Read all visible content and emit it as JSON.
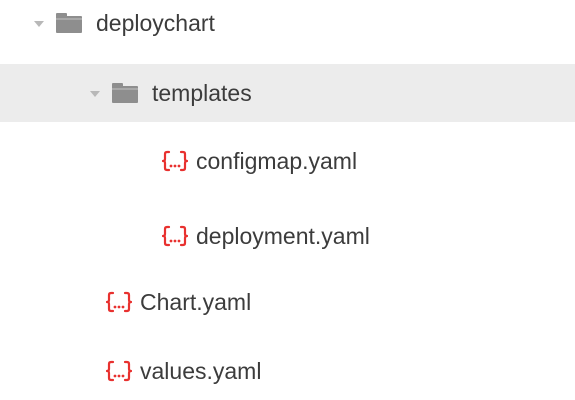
{
  "tree": {
    "root": {
      "label": "deploychart",
      "icon": "folder-icon",
      "expanded": true
    },
    "templates": {
      "label": "templates",
      "icon": "folder-icon",
      "expanded": true,
      "selected": true
    },
    "configmap": {
      "label": "configmap.yaml",
      "icon": "yaml-file-icon"
    },
    "deployment": {
      "label": "deployment.yaml",
      "icon": "yaml-file-icon"
    },
    "chart": {
      "label": "Chart.yaml",
      "icon": "yaml-file-icon"
    },
    "values": {
      "label": "values.yaml",
      "icon": "yaml-file-icon"
    }
  },
  "colors": {
    "selected_row": "#ececec",
    "folder_icon": "#8e8e8e",
    "caret": "#b8b8b8",
    "file_icon": "#e8312f",
    "text": "#3c3c3c"
  }
}
